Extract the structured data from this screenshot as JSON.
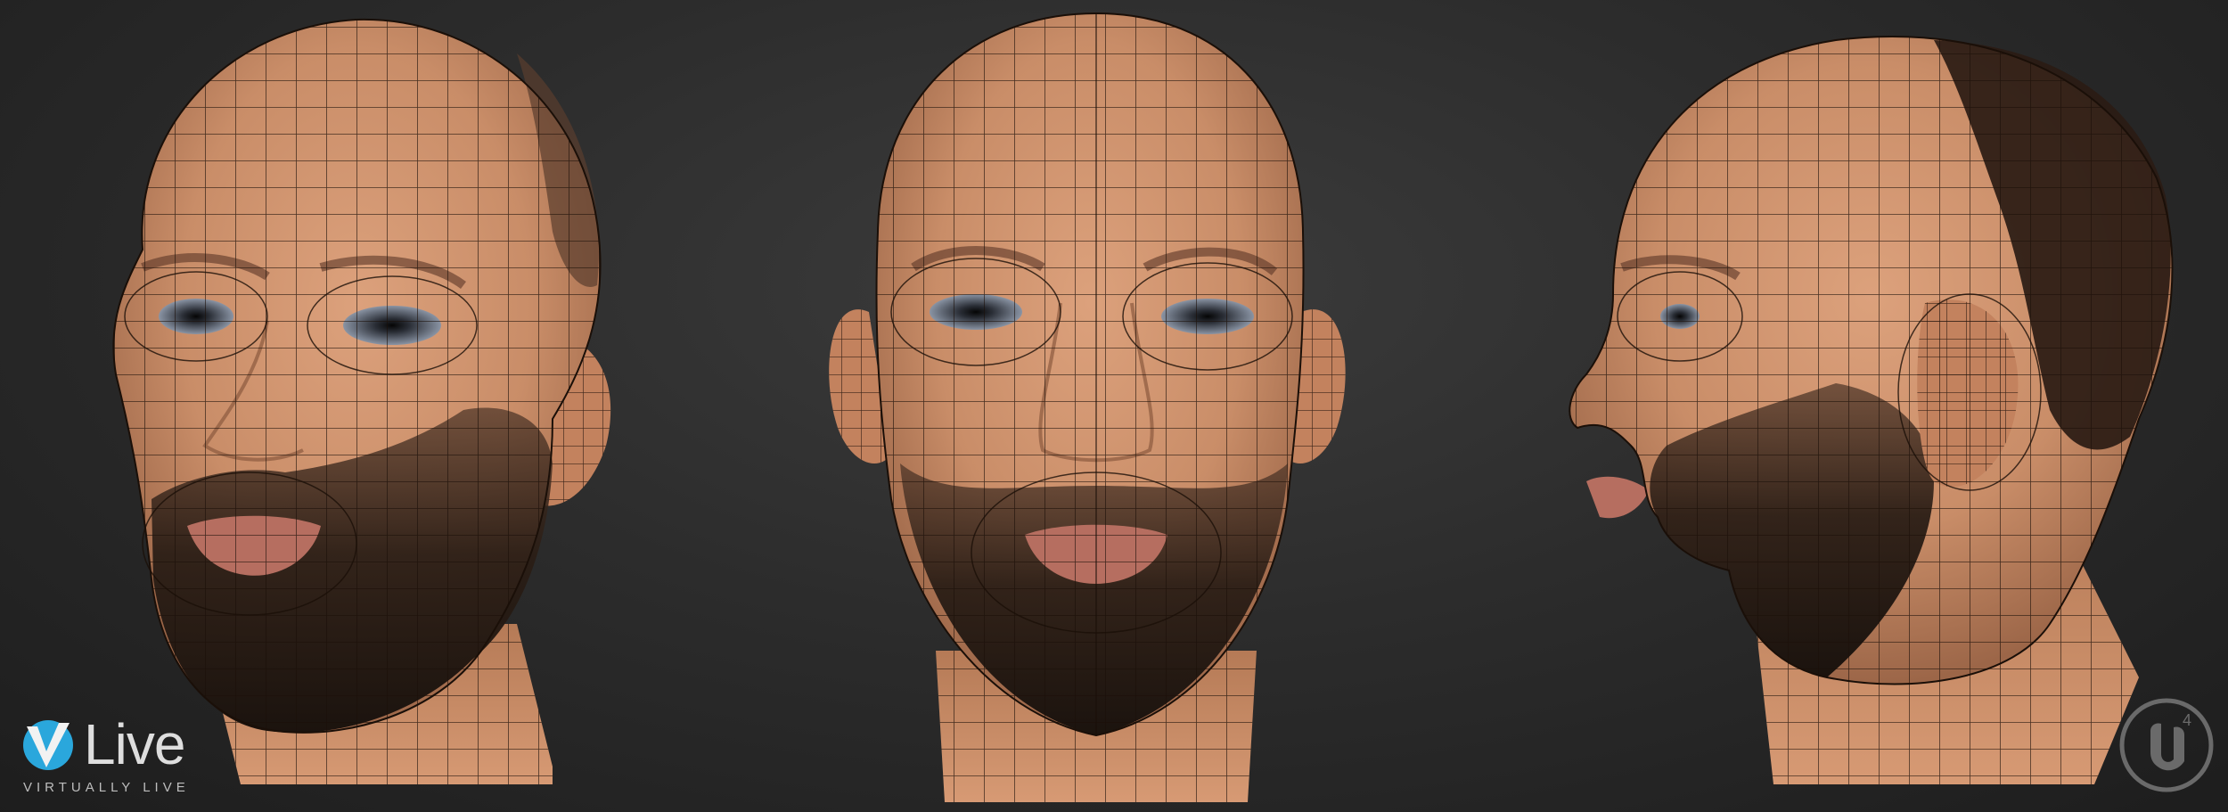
{
  "logos": {
    "vlive": {
      "brand": "Live",
      "tagline": "VIRTUALLY LIVE",
      "accent": "#2aa7dc"
    },
    "unreal": {
      "icon": "unreal-engine-4-logo"
    }
  },
  "views": [
    {
      "name": "three-quarter-left"
    },
    {
      "name": "front"
    },
    {
      "name": "right-profile"
    }
  ],
  "colors": {
    "background": "#2c2c2c",
    "skin": "#c98d68",
    "beard": "#2b1e16",
    "wireframe": "#1a0f08"
  }
}
